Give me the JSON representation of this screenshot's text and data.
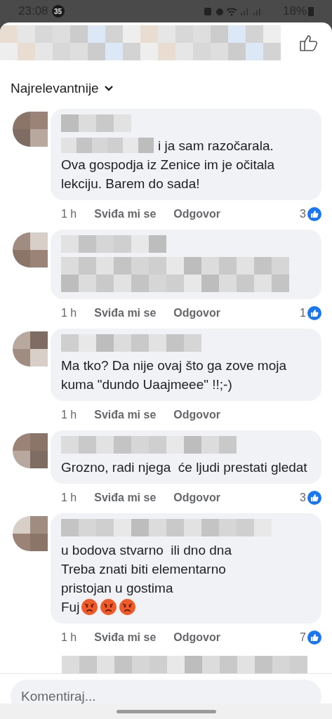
{
  "status_bar": {
    "time": "23:08",
    "notification_count": "35",
    "battery": "18%"
  },
  "sort": {
    "label": "Najrelevantnije"
  },
  "comments": [
    {
      "kind": "prefixed",
      "text_head": "i ja sam razočarala.",
      "text": "Ova gospodja iz Zenice im je očitala lekciju. Barem do sada!",
      "time": "1 h",
      "like": "Sviđa mi se",
      "reply": "Odgovor",
      "reactions": "3"
    },
    {
      "kind": "hidden",
      "time": "1 h",
      "like": "Sviđa mi se",
      "reply": "Odgovor",
      "reactions": "1"
    },
    {
      "kind": "plain",
      "text": "Ma tko? Da nije ovaj što ga zove moja kuma \"dundo Uaajmeee\" !!;-)",
      "time": "1 h",
      "like": "Sviđa mi se",
      "reply": "Odgovor"
    },
    {
      "kind": "plain",
      "text": "Grozno, radi njega  će ljudi prestati gledat",
      "time": "1 h",
      "like": "Sviđa mi se",
      "reply": "Odgovor",
      "reactions": "3"
    },
    {
      "kind": "lines",
      "lines": [
        "u bodova stvarno  ili dno dna",
        "Treba znati biti elementarno",
        "pristojan u gostima",
        "Fuj"
      ],
      "emojis": [
        {
          "kind": "angry"
        },
        {
          "kind": "angry"
        },
        {
          "kind": "angry"
        }
      ],
      "time": "1 h",
      "like": "Sviđa mi se",
      "reply": "Odgovor",
      "reactions": "7"
    }
  ],
  "composer": {
    "placeholder": "Komentiraj..."
  }
}
